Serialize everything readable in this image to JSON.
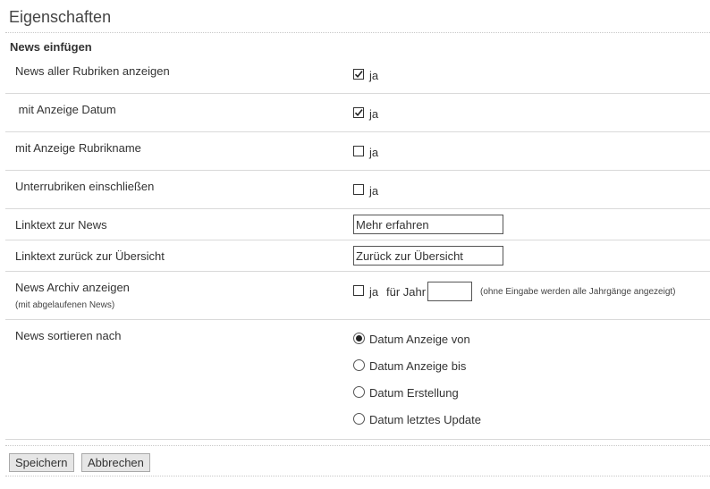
{
  "page": {
    "title": "Eigenschaften",
    "section_title": "News einfügen"
  },
  "form": {
    "rows": [
      {
        "label": "News aller Rubriken anzeigen",
        "checked": true,
        "option_label": "ja"
      },
      {
        "label": " mit Anzeige Datum",
        "checked": true,
        "option_label": "ja"
      },
      {
        "label": "mit Anzeige Rubrikname",
        "checked": false,
        "option_label": "ja"
      },
      {
        "label": "Unterrubriken einschließen",
        "checked": false,
        "option_label": "ja"
      }
    ],
    "linktext_news": {
      "label": "Linktext zur News",
      "value": "Mehr erfahren"
    },
    "linktext_back": {
      "label": "Linktext zurück zur Übersicht",
      "value": "Zurück zur Übersicht"
    },
    "archive": {
      "label": "News Archiv anzeigen",
      "sublabel": "(mit abgelaufenen News)",
      "checked": false,
      "option_label": "ja",
      "year_label": "für Jahr",
      "year_value": "",
      "hint": "(ohne Eingabe werden alle Jahrgänge angezeigt)"
    },
    "sort": {
      "label": "News sortieren nach",
      "options": [
        {
          "label": "Datum Anzeige von",
          "selected": true
        },
        {
          "label": "Datum Anzeige bis",
          "selected": false
        },
        {
          "label": "Datum Erstellung",
          "selected": false
        },
        {
          "label": "Datum letztes Update",
          "selected": false
        }
      ]
    }
  },
  "buttons": {
    "save_label": "Speichern",
    "cancel_label": "Abbrechen"
  }
}
